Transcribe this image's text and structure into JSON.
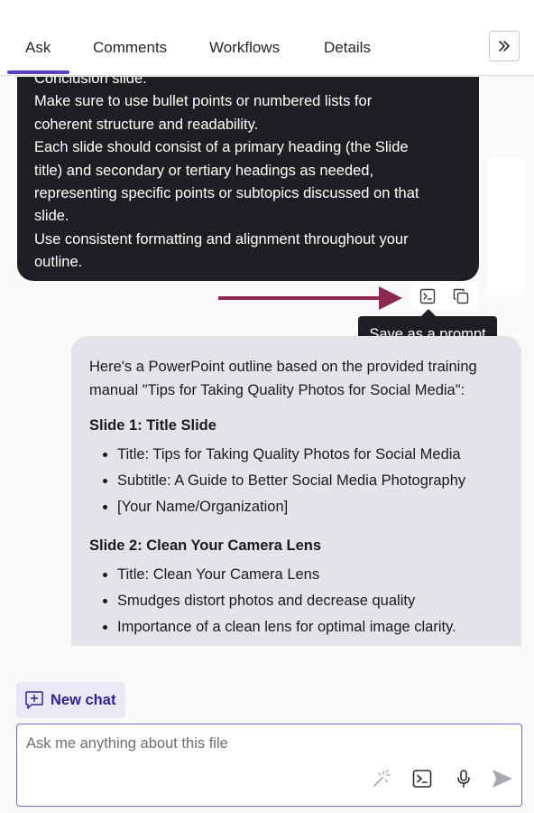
{
  "tabs": {
    "items": [
      {
        "label": "Ask",
        "active": true
      },
      {
        "label": "Comments",
        "active": false
      },
      {
        "label": "Workflows",
        "active": false
      },
      {
        "label": "Details",
        "active": false
      }
    ],
    "collapse_icon": "chevrons-right-icon"
  },
  "colors": {
    "accent": "#5c3fc4",
    "arrow": "#8e2a52",
    "user_bubble": "#1e1f22",
    "ai_bubble": "#e3e3e8",
    "new_chat_bg": "#ebe8f5"
  },
  "user_message": {
    "lines": [
      "Conclusion slide.",
      "Make sure to use bullet points or numbered lists for",
      "coherent structure and readability.",
      "Each slide should consist of a primary heading (the Slide",
      "title) and secondary or tertiary headings as needed,",
      "representing specific points or subtopics discussed on that",
      "slide.",
      "Use consistent formatting and alignment throughout your",
      "outline."
    ]
  },
  "message_actions": {
    "save_prompt_icon": "terminal-prompt-icon",
    "copy_icon": "copy-icon",
    "tooltip": "Save as a prompt"
  },
  "ai_message": {
    "intro_lines": [
      "Here's a PowerPoint outline based on the provided training",
      "manual \"Tips for Taking Quality Photos for Social Media\":"
    ],
    "sections": [
      {
        "heading": "Slide 1: Title Slide",
        "bullets": [
          "Title: Tips for Taking Quality Photos for Social Media",
          "Subtitle: A Guide to Better Social Media Photography",
          "[Your Name/Organization]"
        ]
      },
      {
        "heading": "Slide 2: Clean Your Camera Lens",
        "bullets": [
          "Title: Clean Your Camera Lens",
          "Smudges distort photos and decrease quality",
          "Importance of a clean lens for optimal image clarity."
        ]
      }
    ]
  },
  "new_chat": {
    "label": "New chat",
    "icon": "chat-plus-icon"
  },
  "input": {
    "placeholder": "Ask me anything about this file",
    "value": "",
    "icons": [
      "magic-wand-icon",
      "terminal-prompt-icon",
      "microphone-icon",
      "send-icon"
    ]
  }
}
